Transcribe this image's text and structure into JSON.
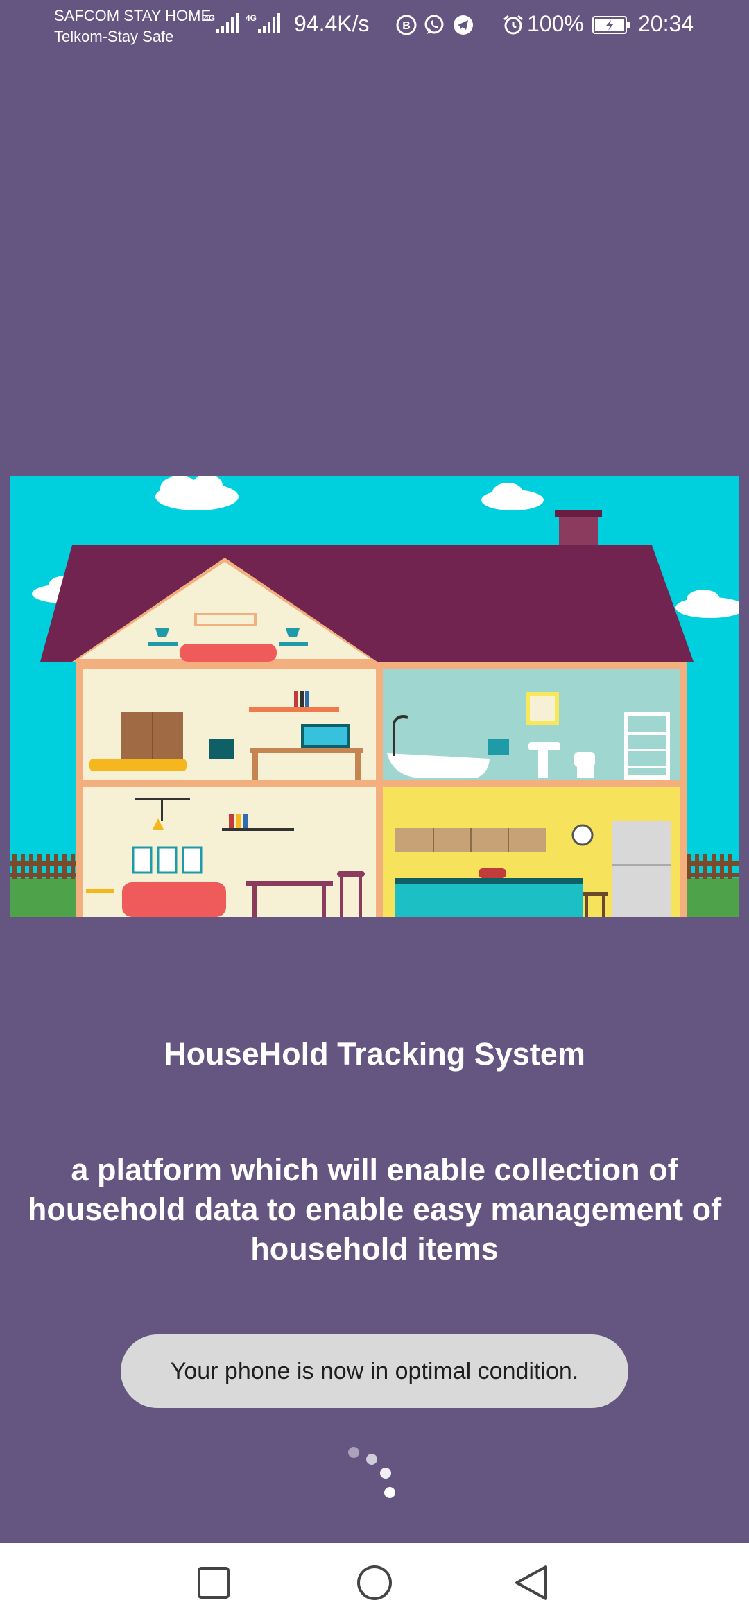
{
  "status_bar": {
    "carrier_1": "SAFCOM STAY HOME",
    "carrier_2": "Telkom-Stay Safe",
    "network_1": "4G",
    "network_2": "4G",
    "net_speed": "94.4K/s",
    "battery_percent": "100%",
    "time": "20:34",
    "icons": [
      "signal-icon",
      "signal-icon",
      "b-app-icon",
      "whatsapp-icon",
      "telegram-icon",
      "alarm-icon",
      "battery-icon"
    ]
  },
  "main": {
    "illustration": "house-cutaway-illustration",
    "title": "HouseHold Tracking System",
    "description": "a platform which will enable collection of household data to enable easy management of household items"
  },
  "toast": {
    "message": "Your phone is now in optimal condition."
  },
  "nav_bar": {
    "buttons": [
      "recent-apps-icon",
      "home-icon",
      "back-icon"
    ]
  },
  "colors": {
    "background": "#655581",
    "toast_background": "#d9d9d9",
    "nav_background": "#ffffff",
    "sky": "#00d0de",
    "roof": "#722450"
  }
}
